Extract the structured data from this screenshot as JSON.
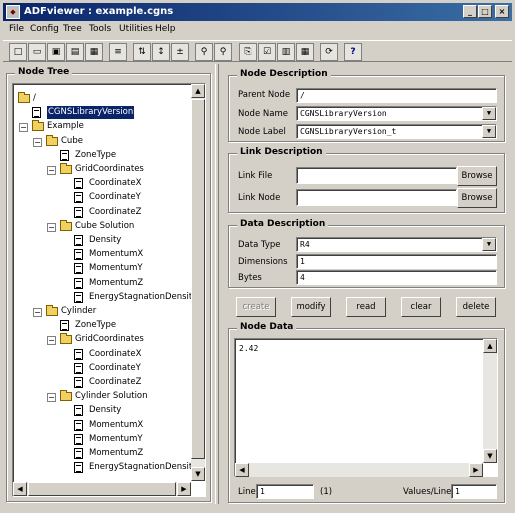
{
  "window": {
    "title": "ADFviewer : example.cgns",
    "minimize": "_",
    "maximize": "□",
    "close": "×"
  },
  "menu": [
    "File",
    "Config",
    "Tree",
    "Tools",
    "Utilities",
    "Help"
  ],
  "toolbar": [
    {
      "name": "new-file",
      "glyph": "□"
    },
    {
      "name": "open-file",
      "glyph": "▭"
    },
    {
      "name": "save-file",
      "glyph": "▣"
    },
    {
      "name": "save-as",
      "glyph": "▤"
    },
    {
      "name": "properties",
      "glyph": "▦"
    },
    {
      "name": "list-view",
      "glyph": "≡"
    },
    {
      "name": "sort",
      "glyph": "⇅"
    },
    {
      "name": "move-node",
      "glyph": "↕"
    },
    {
      "name": "numbers",
      "glyph": "±"
    },
    {
      "name": "find",
      "glyph": "⚲"
    },
    {
      "name": "find-next",
      "glyph": "⚲"
    },
    {
      "name": "copy-node",
      "glyph": "⎘"
    },
    {
      "name": "check",
      "glyph": "☑"
    },
    {
      "name": "plot",
      "glyph": "▥"
    },
    {
      "name": "grid",
      "glyph": "▦"
    },
    {
      "name": "refresh",
      "glyph": "⟳"
    },
    {
      "name": "help",
      "glyph": "?"
    }
  ],
  "node_tree": {
    "title": "Node Tree",
    "rows": [
      {
        "label": "/",
        "kind": "folder",
        "depth": 0,
        "exp": ""
      },
      {
        "label": "CGNSLibraryVersion",
        "kind": "doc",
        "depth": 1,
        "exp": "",
        "selected": true
      },
      {
        "label": "Example",
        "kind": "folder",
        "depth": 1,
        "exp": "−"
      },
      {
        "label": "Cube",
        "kind": "folder",
        "depth": 2,
        "exp": "−"
      },
      {
        "label": "ZoneType",
        "kind": "doc",
        "depth": 3,
        "exp": ""
      },
      {
        "label": "GridCoordinates",
        "kind": "folder",
        "depth": 3,
        "exp": "−"
      },
      {
        "label": "CoordinateX",
        "kind": "doc",
        "depth": 4,
        "exp": ""
      },
      {
        "label": "CoordinateY",
        "kind": "doc",
        "depth": 4,
        "exp": ""
      },
      {
        "label": "CoordinateZ",
        "kind": "doc",
        "depth": 4,
        "exp": ""
      },
      {
        "label": "Cube Solution",
        "kind": "folder",
        "depth": 3,
        "exp": "−"
      },
      {
        "label": "Density",
        "kind": "doc",
        "depth": 4,
        "exp": ""
      },
      {
        "label": "MomentumX",
        "kind": "doc",
        "depth": 4,
        "exp": ""
      },
      {
        "label": "MomentumY",
        "kind": "doc",
        "depth": 4,
        "exp": ""
      },
      {
        "label": "MomentumZ",
        "kind": "doc",
        "depth": 4,
        "exp": ""
      },
      {
        "label": "EnergyStagnationDensity",
        "kind": "doc",
        "depth": 4,
        "exp": ""
      },
      {
        "label": "Cylinder",
        "kind": "folder",
        "depth": 2,
        "exp": "−"
      },
      {
        "label": "ZoneType",
        "kind": "doc",
        "depth": 3,
        "exp": ""
      },
      {
        "label": "GridCoordinates",
        "kind": "folder",
        "depth": 3,
        "exp": "−"
      },
      {
        "label": "CoordinateX",
        "kind": "doc",
        "depth": 4,
        "exp": ""
      },
      {
        "label": "CoordinateY",
        "kind": "doc",
        "depth": 4,
        "exp": ""
      },
      {
        "label": "CoordinateZ",
        "kind": "doc",
        "depth": 4,
        "exp": ""
      },
      {
        "label": "Cylinder Solution",
        "kind": "folder",
        "depth": 3,
        "exp": "−"
      },
      {
        "label": "Density",
        "kind": "doc",
        "depth": 4,
        "exp": ""
      },
      {
        "label": "MomentumX",
        "kind": "doc",
        "depth": 4,
        "exp": ""
      },
      {
        "label": "MomentumY",
        "kind": "doc",
        "depth": 4,
        "exp": ""
      },
      {
        "label": "MomentumZ",
        "kind": "doc",
        "depth": 4,
        "exp": ""
      },
      {
        "label": "EnergyStagnationDensity",
        "kind": "doc",
        "depth": 4,
        "exp": ""
      }
    ]
  },
  "node_description": {
    "title": "Node Description",
    "parent_label": "Parent Node",
    "parent_value": "/",
    "name_label": "Node Name",
    "name_value": "CGNSLibraryVersion",
    "node_label_label": "Node Label",
    "node_label_value": "CGNSLibraryVersion_t"
  },
  "link_description": {
    "title": "Link Description",
    "file_label": "Link File",
    "file_value": "",
    "node_label": "Link Node",
    "node_value": "",
    "browse": "Browse"
  },
  "data_description": {
    "title": "Data Description",
    "type_label": "Data Type",
    "type_value": "R4",
    "dims_label": "Dimensions",
    "dims_value": "1",
    "bytes_label": "Bytes",
    "bytes_value": "4"
  },
  "actions": {
    "create": "create",
    "modify": "modify",
    "read": "read",
    "clear": "clear",
    "delete": "delete"
  },
  "node_data": {
    "title": "Node Data",
    "content": "2.42",
    "line_label": "Line",
    "line_value": "1",
    "count": "(1)",
    "vpl_label": "Values/Line",
    "vpl_value": "1"
  },
  "arrows": {
    "up": "▲",
    "down": "▼",
    "left": "◀",
    "right": "▶"
  }
}
